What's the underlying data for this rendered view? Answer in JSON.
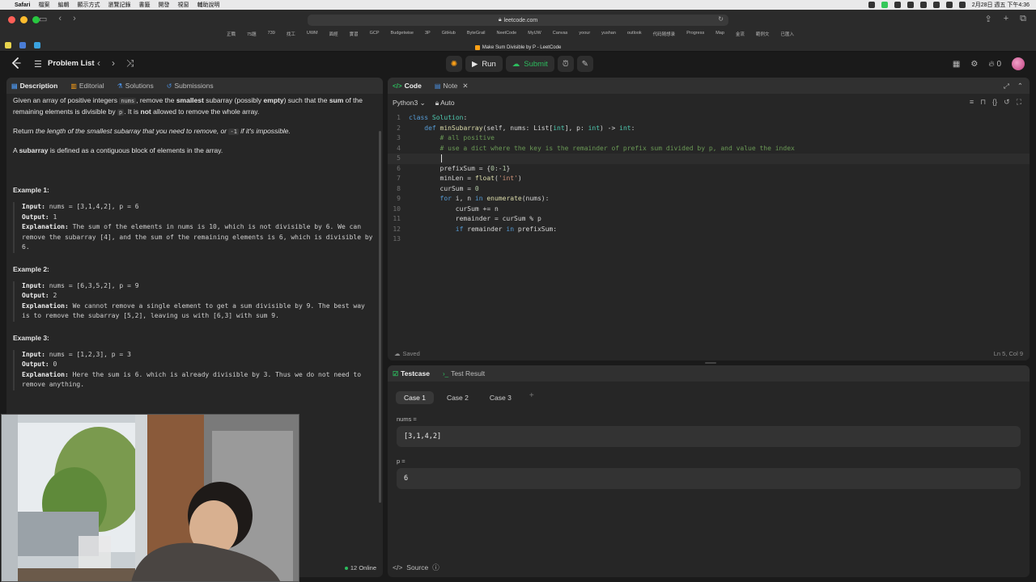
{
  "mac_menubar": {
    "app": "Safari",
    "menus": [
      "檔案",
      "編輯",
      "顯示方式",
      "瀏覽記錄",
      "書籤",
      "開發",
      "視窗",
      "輔助說明"
    ],
    "datetime": "2月28日 週五 下午4:36"
  },
  "browser": {
    "url": "leetcode.com",
    "tab_title": "Make Sum Divisible by P - LeetCode",
    "bookmarks": [
      "正職",
      "75題",
      "739",
      "找工",
      "UWM",
      "面經",
      "實習",
      "GCP",
      "Budgetwise",
      "3P",
      "GitHub",
      "ByteGrail",
      "NeetCode",
      "MyUW",
      "Canvas",
      "yoour",
      "yushan",
      "outlook",
      "代码随想录",
      "Progress",
      "Map",
      "金流",
      "範例文",
      "已匯入"
    ]
  },
  "topbar": {
    "problem_list": "Problem List",
    "run": "Run",
    "submit": "Submit",
    "streak": "0"
  },
  "description_panel": {
    "tabs": [
      "Description",
      "Editorial",
      "Solutions",
      "Submissions"
    ],
    "para1": {
      "a": "Given an array of positive integers ",
      "code1": "nums",
      "b": ", remove the ",
      "smallest": "smallest",
      "c": " subarray (possibly ",
      "empty": "empty",
      "d": ") such that the ",
      "sum": "sum",
      "e": " of the remaining elements is divisible by ",
      "code2": "p",
      "f": ". It is ",
      "not": "not",
      "g": " allowed to remove the whole array."
    },
    "para2": {
      "a": "Return ",
      "b": "the length of the smallest subarray that you need to remove, or ",
      "code": "-1",
      "c": " if it's impossible."
    },
    "para3": {
      "a": "A ",
      "b": "subarray",
      "c": " is defined as a contiguous block of elements in the array."
    },
    "examples": [
      {
        "title": "Example 1:",
        "input": "nums = [3,1,4,2], p = 6",
        "output": "1",
        "explanation": "The sum of the elements in nums is 10, which is not divisible by 6. We can remove the subarray [4], and the sum of the remaining elements is 6, which is divisible by 6."
      },
      {
        "title": "Example 2:",
        "input": "nums = [6,3,5,2], p = 9",
        "output": "2",
        "explanation": "We cannot remove a single element to get a sum divisible by 9. The best way is to remove the subarray [5,2], leaving us with [6,3] with sum 9."
      },
      {
        "title": "Example 3:",
        "input": "nums = [1,2,3], p = 3",
        "output": "0",
        "explanation": "Here the sum is 6. which is already divisible by 3. Thus we do not need to remove anything."
      }
    ],
    "labels": {
      "input": "Input:",
      "output": "Output:",
      "explanation": "Explanation:"
    },
    "online": "12 Online"
  },
  "code_panel": {
    "tabs": [
      "Code",
      "Note"
    ],
    "language": "Python3",
    "mode": "Auto",
    "status": "Saved",
    "cursor_pos": "Ln 5, Col 9",
    "line_numbers": [
      "1",
      "2",
      "3",
      "4",
      "5",
      "6",
      "7",
      "8",
      "9",
      "10",
      "11",
      "12",
      "13"
    ],
    "code": {
      "l1_kw": "class",
      "l1_cls": "Solution",
      "l1_end": ":",
      "l2_kw": "def",
      "l2_fn": "minSubarray",
      "l2_a": "(self, nums: List[",
      "l2_int1": "int",
      "l2_b": "], p: ",
      "l2_int2": "int",
      "l2_c": ") -> ",
      "l2_int3": "int",
      "l2_d": ":",
      "l3": "# all positive",
      "l4": "# use a dict where the key is the remainder of prefix sum divided by p, and value the index",
      "l6_a": "prefixSum = {",
      "l6_n1": "0",
      "l6_b": ":-",
      "l6_n2": "1",
      "l6_c": "}",
      "l7_a": "minLen = ",
      "l7_fn": "float",
      "l7_b": "(",
      "l7_str": "'int'",
      "l7_c": ")",
      "l8_a": "curSum = ",
      "l8_n": "0",
      "l9_kw": "for",
      "l9_a": " i, n ",
      "l9_in": "in",
      "l9_fn": "enumerate",
      "l9_b": "(nums):",
      "l10": "curSum += n",
      "l11": "remainder = curSum % p",
      "l12_kw": "if",
      "l12_a": " remainder ",
      "l12_in": "in",
      "l12_b": " prefixSum:"
    }
  },
  "test_panel": {
    "tabs": [
      "Testcase",
      "Test Result"
    ],
    "cases": [
      "Case 1",
      "Case 2",
      "Case 3"
    ],
    "nums_label": "nums =",
    "nums_value": "[3,1,4,2]",
    "p_label": "p =",
    "p_value": "6",
    "source": "Source"
  },
  "colors": {
    "accent_orange": "#ffa116",
    "submit_green": "#2cbb5d"
  }
}
